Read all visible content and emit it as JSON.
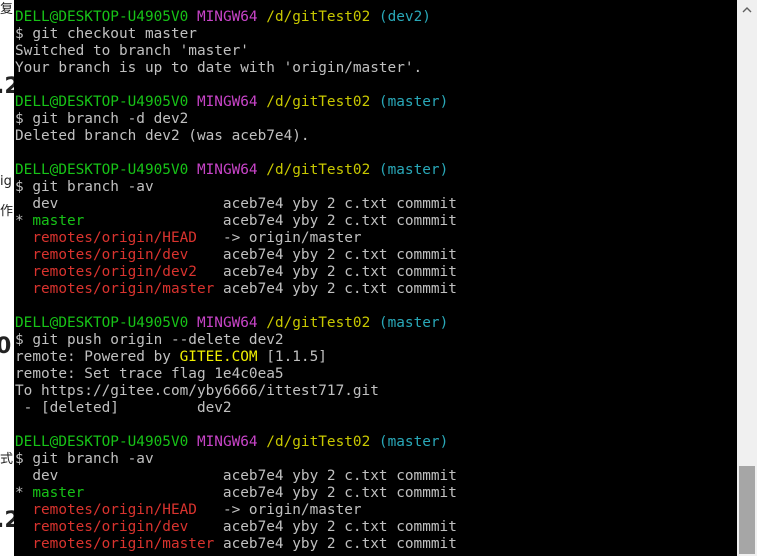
{
  "background_window": {
    "fragments": [
      "复",
      ".2",
      "ig",
      "作",
      "0",
      "式",
      ".2"
    ]
  },
  "terminal": {
    "lines": [
      {
        "segments": [
          {
            "text": "DELL@DESKTOP-U4905V0",
            "color": "green"
          },
          {
            "text": " "
          },
          {
            "text": "MINGW64",
            "color": "magenta"
          },
          {
            "text": " "
          },
          {
            "text": "/d/gitTest02",
            "color": "yellow"
          },
          {
            "text": " "
          },
          {
            "text": "(dev2)",
            "color": "cyan"
          }
        ]
      },
      {
        "segments": [
          {
            "text": "$ git checkout master"
          }
        ]
      },
      {
        "segments": [
          {
            "text": "Switched to branch 'master'"
          }
        ]
      },
      {
        "segments": [
          {
            "text": "Your branch is up to date with 'origin/master'."
          }
        ]
      },
      {
        "segments": [
          {
            "text": ""
          }
        ]
      },
      {
        "segments": [
          {
            "text": "DELL@DESKTOP-U4905V0",
            "color": "green"
          },
          {
            "text": " "
          },
          {
            "text": "MINGW64",
            "color": "magenta"
          },
          {
            "text": " "
          },
          {
            "text": "/d/gitTest02",
            "color": "yellow"
          },
          {
            "text": " "
          },
          {
            "text": "(master)",
            "color": "cyan"
          }
        ]
      },
      {
        "segments": [
          {
            "text": "$ git branch -d dev2"
          }
        ]
      },
      {
        "segments": [
          {
            "text": "Deleted branch dev2 (was aceb7e4)."
          }
        ]
      },
      {
        "segments": [
          {
            "text": ""
          }
        ]
      },
      {
        "segments": [
          {
            "text": "DELL@DESKTOP-U4905V0",
            "color": "green"
          },
          {
            "text": " "
          },
          {
            "text": "MINGW64",
            "color": "magenta"
          },
          {
            "text": " "
          },
          {
            "text": "/d/gitTest02",
            "color": "yellow"
          },
          {
            "text": " "
          },
          {
            "text": "(master)",
            "color": "cyan"
          }
        ]
      },
      {
        "segments": [
          {
            "text": "$ git branch -av"
          }
        ]
      },
      {
        "segments": [
          {
            "text": "  dev                   aceb7e4 yby 2 c.txt commmit"
          }
        ]
      },
      {
        "segments": [
          {
            "text": "* "
          },
          {
            "text": "master",
            "color": "green"
          },
          {
            "text": "                aceb7e4 yby 2 c.txt commmit"
          }
        ]
      },
      {
        "segments": [
          {
            "text": "  "
          },
          {
            "text": "remotes/origin/HEAD",
            "color": "red"
          },
          {
            "text": "   -> origin/master"
          }
        ]
      },
      {
        "segments": [
          {
            "text": "  "
          },
          {
            "text": "remotes/origin/dev",
            "color": "red"
          },
          {
            "text": "    aceb7e4 yby 2 c.txt commmit"
          }
        ]
      },
      {
        "segments": [
          {
            "text": "  "
          },
          {
            "text": "remotes/origin/dev2",
            "color": "red"
          },
          {
            "text": "   aceb7e4 yby 2 c.txt commmit"
          }
        ]
      },
      {
        "segments": [
          {
            "text": "  "
          },
          {
            "text": "remotes/origin/master",
            "color": "red"
          },
          {
            "text": " aceb7e4 yby 2 c.txt commmit"
          }
        ]
      },
      {
        "segments": [
          {
            "text": ""
          }
        ]
      },
      {
        "segments": [
          {
            "text": "DELL@DESKTOP-U4905V0",
            "color": "green"
          },
          {
            "text": " "
          },
          {
            "text": "MINGW64",
            "color": "magenta"
          },
          {
            "text": " "
          },
          {
            "text": "/d/gitTest02",
            "color": "yellow"
          },
          {
            "text": " "
          },
          {
            "text": "(master)",
            "color": "cyan"
          }
        ]
      },
      {
        "segments": [
          {
            "text": "$ git push origin --delete dev2"
          }
        ]
      },
      {
        "segments": [
          {
            "text": "remote: Powered by "
          },
          {
            "text": "GITEE.COM",
            "color": "gitee"
          },
          {
            "text": " [1.1.5]"
          }
        ]
      },
      {
        "segments": [
          {
            "text": "remote: Set trace flag 1e4c0ea5"
          }
        ]
      },
      {
        "segments": [
          {
            "text": "To https://gitee.com/yby6666/ittest717.git"
          }
        ]
      },
      {
        "segments": [
          {
            "text": " - [deleted]         dev2"
          }
        ]
      },
      {
        "segments": [
          {
            "text": ""
          }
        ]
      },
      {
        "segments": [
          {
            "text": "DELL@DESKTOP-U4905V0",
            "color": "green"
          },
          {
            "text": " "
          },
          {
            "text": "MINGW64",
            "color": "magenta"
          },
          {
            "text": " "
          },
          {
            "text": "/d/gitTest02",
            "color": "yellow"
          },
          {
            "text": " "
          },
          {
            "text": "(master)",
            "color": "cyan"
          }
        ]
      },
      {
        "segments": [
          {
            "text": "$ git branch -av"
          }
        ]
      },
      {
        "segments": [
          {
            "text": "  dev                   aceb7e4 yby 2 c.txt commmit"
          }
        ]
      },
      {
        "segments": [
          {
            "text": "* "
          },
          {
            "text": "master",
            "color": "green"
          },
          {
            "text": "                aceb7e4 yby 2 c.txt commmit"
          }
        ]
      },
      {
        "segments": [
          {
            "text": "  "
          },
          {
            "text": "remotes/origin/HEAD",
            "color": "red"
          },
          {
            "text": "   -> origin/master"
          }
        ]
      },
      {
        "segments": [
          {
            "text": "  "
          },
          {
            "text": "remotes/origin/dev",
            "color": "red"
          },
          {
            "text": "    aceb7e4 yby 2 c.txt commmit"
          }
        ]
      },
      {
        "segments": [
          {
            "text": "  "
          },
          {
            "text": "remotes/origin/master",
            "color": "red"
          },
          {
            "text": " aceb7e4 yby 2 c.txt commmit"
          }
        ]
      }
    ]
  },
  "colors": {
    "background": "#000000",
    "default_text": "#c0c0c0",
    "green": "#17c217",
    "magenta": "#c844c8",
    "yellow": "#c8c800",
    "cyan": "#29a8b8",
    "red": "#d9332e",
    "gitee": "#f0f000"
  },
  "scrollbar": {
    "up_icon": "chevron-up-icon",
    "position": 0.97
  }
}
